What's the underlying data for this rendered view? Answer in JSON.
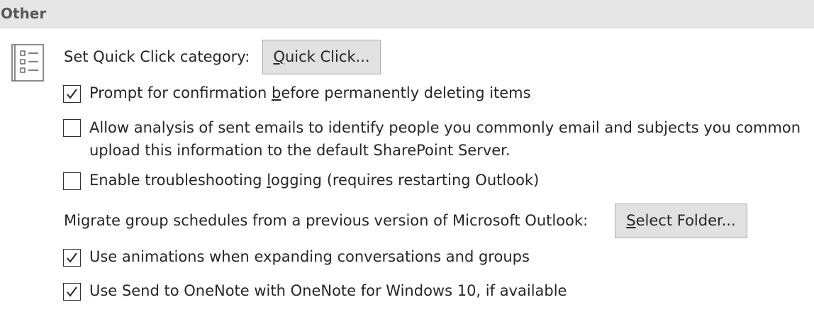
{
  "header": {
    "title": "Other"
  },
  "quick_click": {
    "label": "Set Quick Click category:",
    "button": {
      "pre": "",
      "accel": "Q",
      "post": "uick Click..."
    }
  },
  "options": [
    {
      "checked": true,
      "pre": "Prompt for confirmation ",
      "accel": "b",
      "post": "efore permanently deleting items"
    },
    {
      "checked": false,
      "line1": "Allow analysis of sent emails to identify people you commonly email and subjects you common",
      "line2": "upload this information to the default SharePoint Server."
    },
    {
      "checked": false,
      "pre": "Enable troubleshooting ",
      "accel": "l",
      "post": "ogging (requires restarting Outlook)"
    },
    {
      "checked": true,
      "text": "Use animations when expanding conversations and groups"
    },
    {
      "checked": true,
      "text": "Use Send to OneNote with OneNote for Windows 10, if available"
    }
  ],
  "migrate": {
    "label": "Migrate group schedules from a previous version of Microsoft Outlook:",
    "button": {
      "pre": "",
      "accel": "S",
      "post": "elect Folder..."
    }
  },
  "icons": {
    "section_icon": "checklist-icon",
    "check": "checkmark-icon"
  }
}
